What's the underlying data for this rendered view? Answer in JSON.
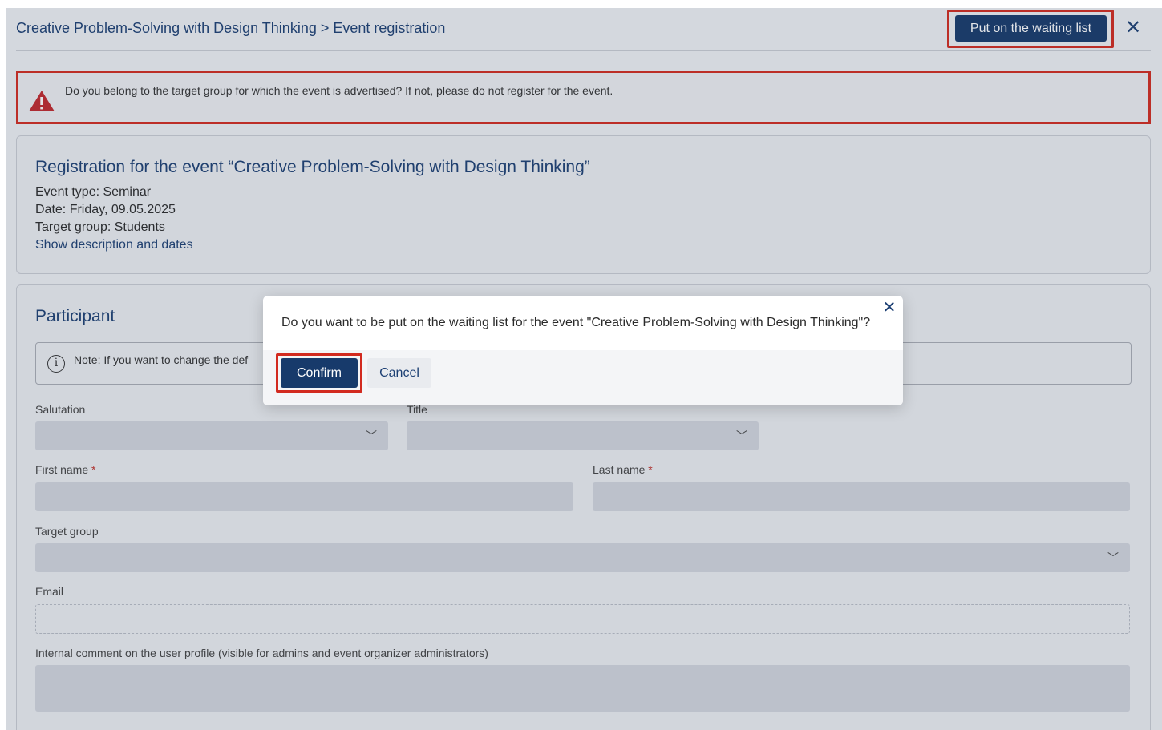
{
  "header": {
    "breadcrumb": "Creative Problem-Solving with Design Thinking > Event registration",
    "waitlist_button": "Put on the waiting list",
    "close_icon": "close-icon"
  },
  "warning": {
    "icon": "warning-icon",
    "text": "Do you belong to the target group for which the event is advertised? If not, please do not register for the event."
  },
  "event": {
    "title": "Registration for the event “Creative Problem-Solving with Design Thinking”",
    "type": "Event type: Seminar",
    "date": "Date: Friday, 09.05.2025",
    "target_group": "Target group: Students",
    "show_link": "Show description and dates"
  },
  "participant": {
    "title": "Participant",
    "note_icon": "info-icon",
    "note": "Note: If you want to change the def",
    "fields": {
      "salutation": "Salutation",
      "title": "Title",
      "first_name": "First name",
      "last_name": "Last name",
      "required_mark": "*",
      "target_group": "Target group",
      "email": "Email",
      "internal_comment": "Internal comment on the user profile (visible for admins and event organizer administrators)"
    }
  },
  "dialog": {
    "message": "Do you want to be put on the waiting list for the event \"Creative Problem-Solving with Design Thinking\"?",
    "confirm": "Confirm",
    "cancel": "Cancel"
  },
  "colors": {
    "primary": "#173a6b",
    "highlight": "#d22a1f",
    "warning": "#c0282d"
  }
}
